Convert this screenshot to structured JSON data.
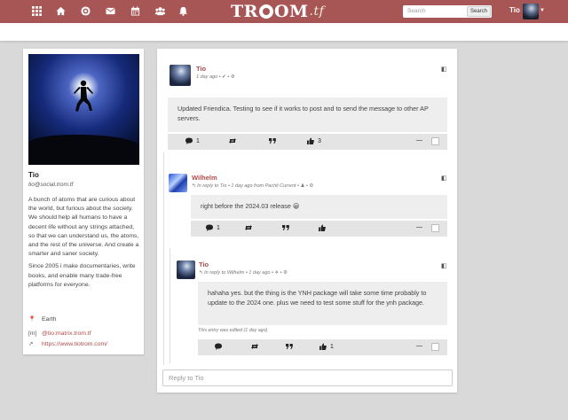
{
  "nav": {
    "icons": [
      "apps-icon",
      "home-icon",
      "network-icon",
      "mail-icon",
      "calendar-icon",
      "contacts-icon",
      "bell-icon"
    ],
    "logo": {
      "main_1": "TR",
      "main_2": "OM",
      "tld": ".tf"
    },
    "search_placeholder": "Search",
    "search_button": "Search",
    "user_name": "Tio"
  },
  "profile": {
    "name": "Tio",
    "handle": "tio@social.trom.tf",
    "bio_1": "A bunch of atoms that are curious about the world, but furious about the society. We should help all humans to have a decent life without any strings attached, so that we can understand us, the atoms, and the rest of the universe. And create a smarter and saner society.",
    "bio_2": "Since 2005 i make documentaries, write books, and enable many trade-free platforms for everyone.",
    "location": "Earth",
    "matrix": "@tio:matrix.trom.tf",
    "website": "https://www.tiotrom.com/"
  },
  "posts": [
    {
      "author": "Tio",
      "meta": "1 day ago • ✔ • ⚙",
      "content": "Updated Friendica. Testing to see if it works to post and to send the message to other AP servers.",
      "comments": "1",
      "likes": "3"
    },
    {
      "author": "Wilhelm",
      "meta": "In reply to Tio • 1 day ago from Pachli Current • ♟ • ⚙",
      "content": "right before the 2024.03 release 😀",
      "comments": "1",
      "likes": ""
    },
    {
      "author": "Tio",
      "meta": "In reply to Wilhelm • 1 day ago • ✈ • ⚙",
      "content": "hahaha yes. but the thing is the YNH package will take some time probably to update to the 2024 one. plus we need to test some stuff for the ynh package.",
      "edited": "This entry was edited (1 day ago)",
      "comments": "",
      "likes": "1"
    }
  ],
  "reply_placeholder": "Reply to Tio"
}
